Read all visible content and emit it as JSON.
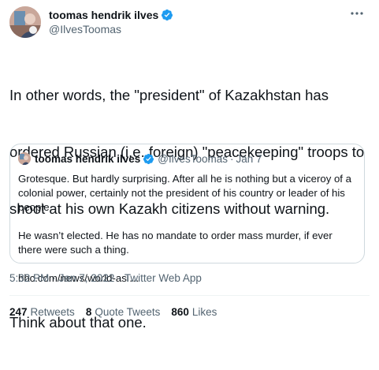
{
  "author": {
    "display_name": "toomas hendrik ilves",
    "handle": "@IlvesToomas"
  },
  "more_icon": "more-horizontal-icon",
  "verified_icon": "verified-badge-icon",
  "body": {
    "lines": [
      "In other words, the \"president\" of Kazakhstan has",
      "ordered Russian (i.e. foreign) \"peacekeeping\" troops to",
      "shoot at his own Kazakh citizens without warning."
    ],
    "closing": "Think about that one."
  },
  "quote": {
    "display_name": "toomas hendrik ilves",
    "handle": "@IlvesToomas",
    "separator": "·",
    "time": "Jan 7",
    "paragraphs": [
      "Grotesque. But hardly surprising. After all he is nothing but a viceroy of a colonial power, certainly not the president of his country or leader of his people.",
      "He wasn’t elected. He has no mandate to order mass murder, if ever there were such a thing.",
      "bbc.com/news/world-asi…"
    ]
  },
  "meta": {
    "time": "5:32 PM",
    "sep1": "·",
    "date": "Jan 7, 2022",
    "sep2": "·",
    "source": "Twitter Web App"
  },
  "stats": [
    {
      "count": "247",
      "label": "Retweets"
    },
    {
      "count": "8",
      "label": "Quote Tweets"
    },
    {
      "count": "860",
      "label": "Likes"
    }
  ],
  "colors": {
    "verified_blue": "#1d9bf0",
    "text_primary": "#0f1419",
    "text_secondary": "#536471",
    "border": "#cfd9de"
  }
}
